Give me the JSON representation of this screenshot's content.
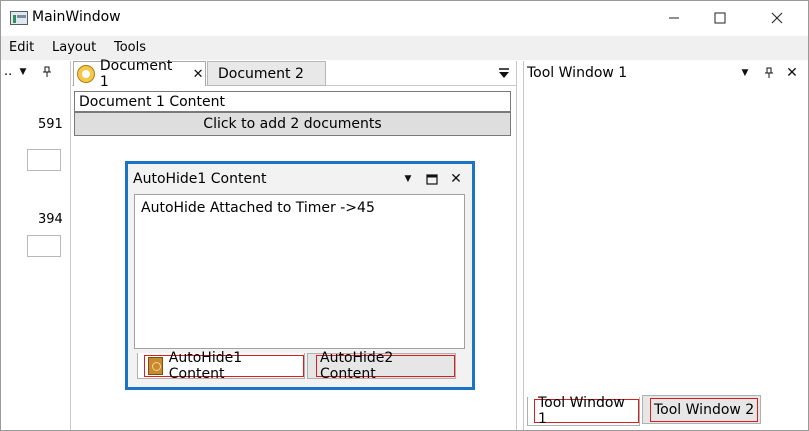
{
  "window": {
    "title": "MainWindow",
    "controls": {
      "minimize": "—",
      "maximize": "☐",
      "close": "✕"
    }
  },
  "menu": {
    "items": [
      {
        "label": "Edit"
      },
      {
        "label": "Layout"
      },
      {
        "label": "Tools"
      }
    ]
  },
  "left_pane": {
    "header_text": "..",
    "value1": "591",
    "value2": "394"
  },
  "documents": {
    "tabs": [
      {
        "label": "Document 1",
        "active": true
      },
      {
        "label": "Document 2",
        "active": false
      }
    ],
    "content_text": "Document 1 Content",
    "add_button_label": "Click to add 2 documents"
  },
  "autohide_panel": {
    "title": "AutoHide1 Content",
    "content_text": "AutoHide Attached to Timer ->45",
    "tabs": [
      {
        "label": "AutoHide1 Content",
        "selected": true
      },
      {
        "label": "AutoHide2 Content",
        "selected": false
      }
    ]
  },
  "tool_window": {
    "title": "Tool Window 1",
    "tabs": [
      {
        "label": "Tool Window 1",
        "selected": true
      },
      {
        "label": "Tool Window 2",
        "selected": false
      }
    ]
  },
  "icons": {
    "dropdown": "▼",
    "pin": "📌",
    "close": "✕",
    "maximize": "☐"
  },
  "colors": {
    "autohide_border": "#1a73c7",
    "highlight_outline": "#d81e1e"
  }
}
